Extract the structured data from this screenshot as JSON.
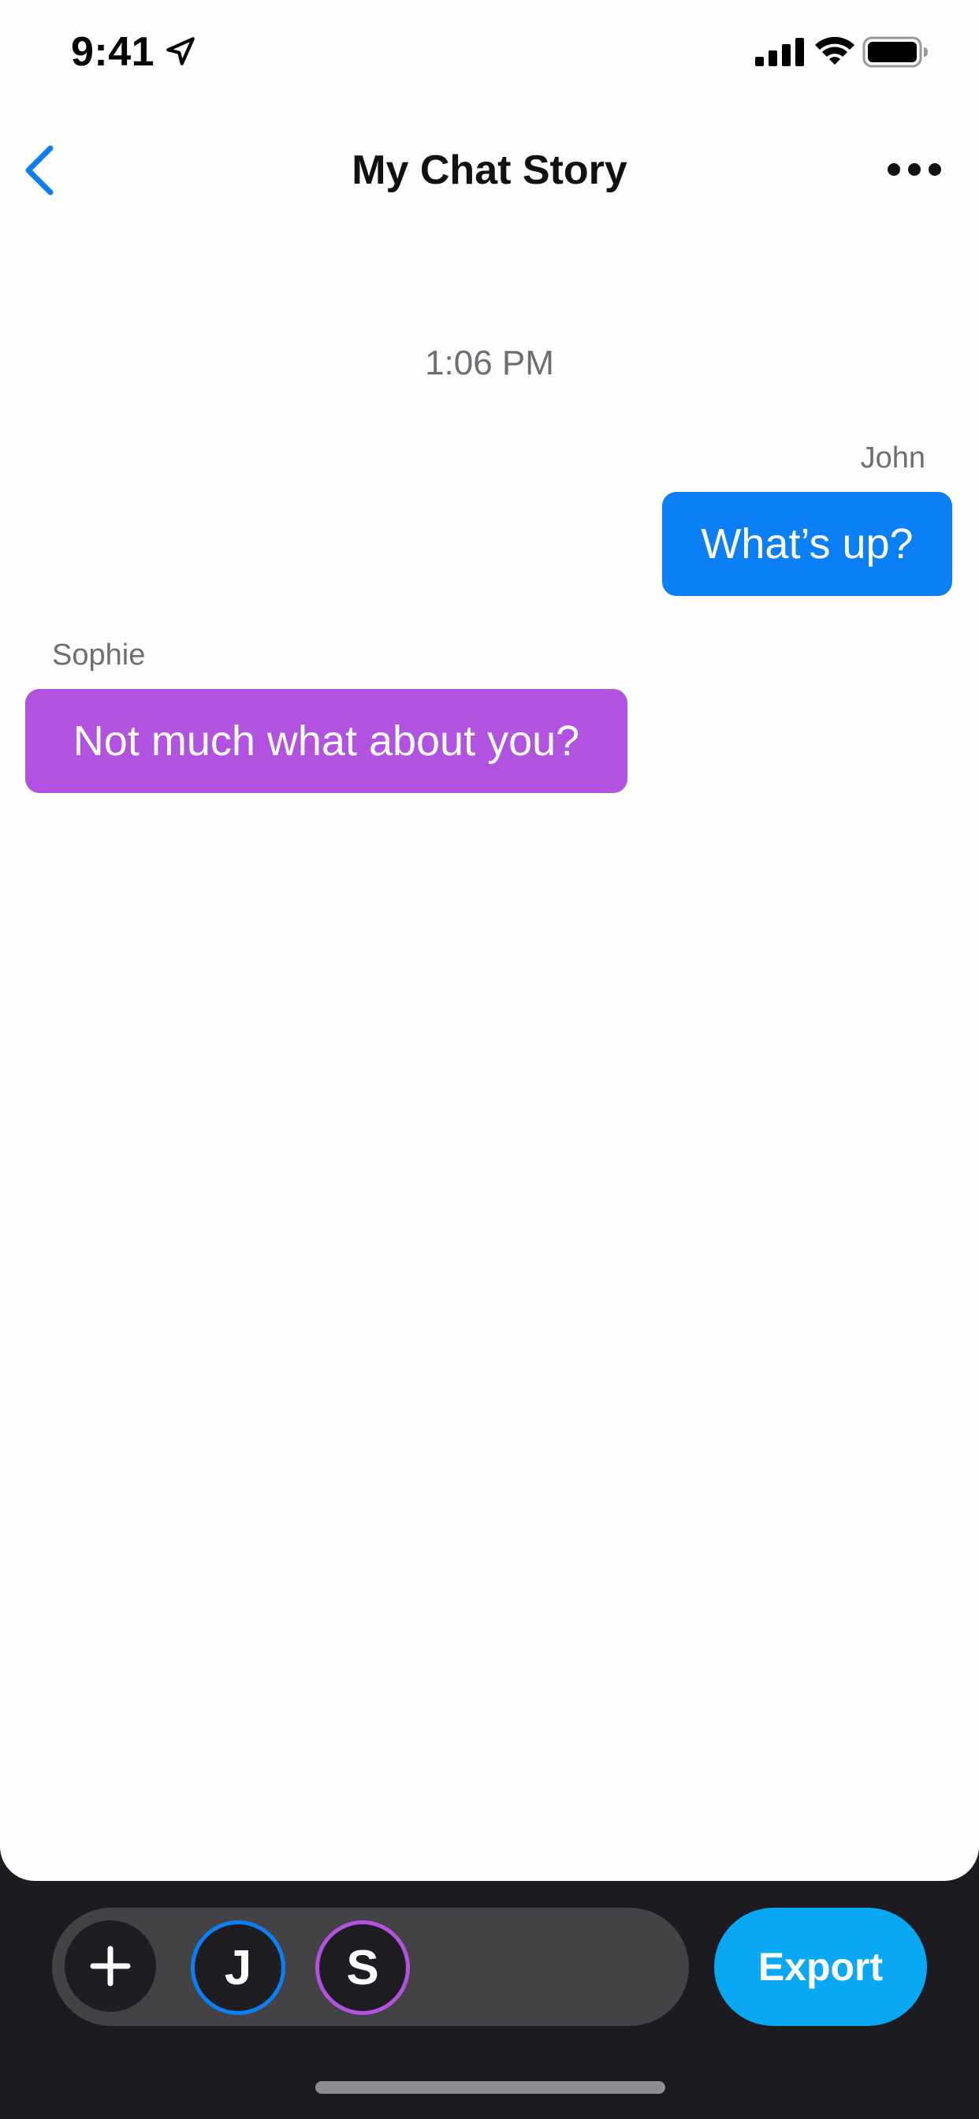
{
  "status_bar": {
    "time": "9:41",
    "icons": [
      "location-arrow-icon",
      "cellular-signal-icon",
      "wifi-icon",
      "battery-icon"
    ]
  },
  "nav": {
    "title": "My Chat Story",
    "back_icon": "chevron-left-icon",
    "more_icon": "ellipsis-icon"
  },
  "chat": {
    "timestamp": "1:06 PM",
    "messages": [
      {
        "sender": "John",
        "text": "What’s up?",
        "side": "right",
        "color": "#0a7ff6"
      },
      {
        "sender": "Sophie",
        "text": "Not much what about you?",
        "side": "left",
        "color": "#b152e0"
      }
    ]
  },
  "bottom_bar": {
    "add_icon": "plus-icon",
    "characters": [
      {
        "initial": "J",
        "ring_color": "#0a7ff6"
      },
      {
        "initial": "S",
        "ring_color": "#b152e0"
      }
    ],
    "export_label": "Export",
    "export_color": "#08a8f4"
  },
  "colors": {
    "accent_blue": "#0a7ff6",
    "sophie_purple": "#b152e0",
    "background": "#fefefe",
    "bottom_bar": "#1c1b1f"
  }
}
